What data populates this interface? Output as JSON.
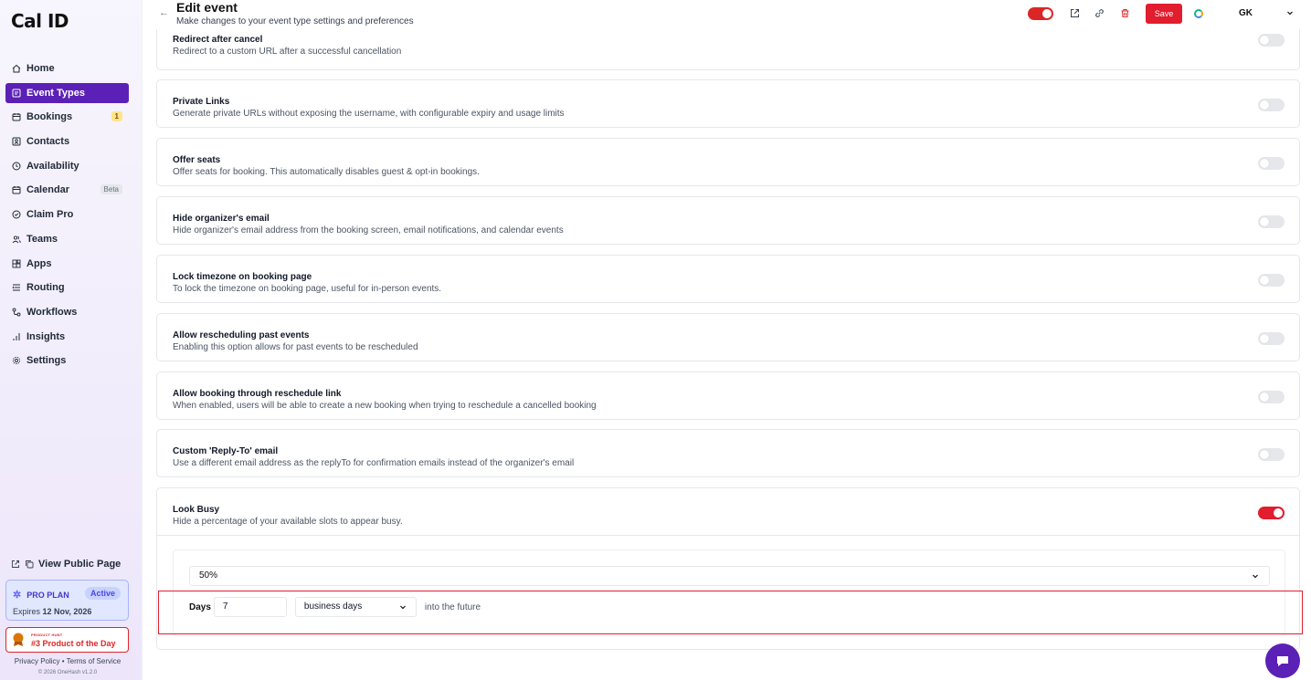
{
  "app": {
    "logo": "Cal ID"
  },
  "sidebar": {
    "items": [
      {
        "label": "Home",
        "icon": "home-icon",
        "active": false
      },
      {
        "label": "Event Types",
        "icon": "link-icon",
        "active": true
      },
      {
        "label": "Bookings",
        "icon": "calendar-check-icon",
        "active": false,
        "badge": "1"
      },
      {
        "label": "Contacts",
        "icon": "contact-icon",
        "active": false
      },
      {
        "label": "Availability",
        "icon": "clock-icon",
        "active": false
      },
      {
        "label": "Calendar",
        "icon": "calendar-icon",
        "active": false,
        "badge": "Beta"
      },
      {
        "label": "Claim Pro",
        "icon": "badge-icon",
        "active": false
      },
      {
        "label": "Teams",
        "icon": "users-icon",
        "active": false
      },
      {
        "label": "Apps",
        "icon": "apps-icon",
        "active": false
      },
      {
        "label": "Routing",
        "icon": "routing-icon",
        "active": false
      },
      {
        "label": "Workflows",
        "icon": "workflow-icon",
        "active": false
      },
      {
        "label": "Insights",
        "icon": "chart-icon",
        "active": false
      },
      {
        "label": "Settings",
        "icon": "gear-icon",
        "active": false
      }
    ],
    "public_page": "View Public Page",
    "plan": {
      "name": "PRO PLAN",
      "status": "Active",
      "expiry_prefix": "Expires",
      "expiry_date": "12 Nov, 2026"
    },
    "product_hunt": {
      "small": "PRODUCT HUNT",
      "title": "#3 Product of the Day"
    },
    "legal": "Privacy Policy • Terms of Service",
    "copyright": "© 2026 OneHash v1.2.0"
  },
  "header": {
    "title": "Edit event",
    "subtitle": "Make changes to your event type settings and preferences",
    "save_label": "Save",
    "user_initials": "GK",
    "hidden_toggle_on": true
  },
  "settings": [
    {
      "title": "Redirect after cancel",
      "desc": "Redirect to a custom URL after a successful cancellation",
      "enabled": false
    },
    {
      "title": "Private Links",
      "desc": "Generate private URLs without exposing the username, with configurable expiry and usage limits",
      "enabled": false
    },
    {
      "title": "Offer seats",
      "desc": "Offer seats for booking. This automatically disables guest & opt-in bookings.",
      "enabled": false
    },
    {
      "title": "Hide organizer's email",
      "desc": "Hide organizer's email address from the booking screen, email notifications, and calendar events",
      "enabled": false
    },
    {
      "title": "Lock timezone on booking page",
      "desc": "To lock the timezone on booking page, useful for in-person events.",
      "enabled": false
    },
    {
      "title": "Allow rescheduling past events",
      "desc": "Enabling this option allows for past events to be rescheduled",
      "enabled": false
    },
    {
      "title": "Allow booking through reschedule link",
      "desc": "When enabled, users will be able to create a new booking when trying to reschedule a cancelled booking",
      "enabled": false
    },
    {
      "title": "Custom 'Reply-To' email",
      "desc": "Use a different email address as the replyTo for confirmation emails instead of the organizer's email",
      "enabled": false
    }
  ],
  "look_busy": {
    "title": "Look Busy",
    "desc": "Hide a percentage of your available slots to appear busy.",
    "enabled": true,
    "percentage": "50%",
    "days_label": "Days",
    "days_value": "7",
    "days_type": "business days",
    "suffix": "into the future"
  },
  "colors": {
    "brand": "#5b21b6",
    "accent": "#e11d2e"
  }
}
